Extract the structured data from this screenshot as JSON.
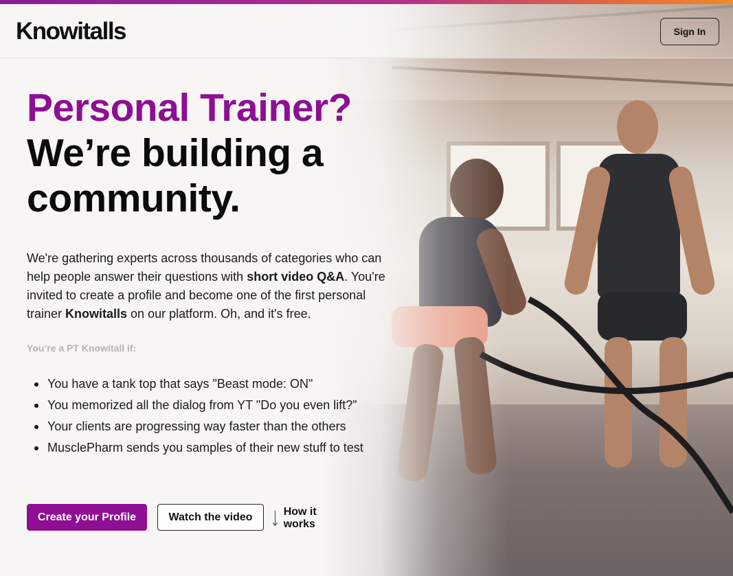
{
  "app": {
    "logo": "Knowitalls"
  },
  "header": {
    "signin_label": "Sign In"
  },
  "hero": {
    "title_accent": "Personal Trainer?",
    "title_rest": "We’re building a community."
  },
  "intro": {
    "p1": "We're gathering experts across thousands of categories who can help people answer their questions with ",
    "b1": "short video Q&A",
    "p2": ". You're invited to create a profile and become one of the first personal trainer ",
    "b2": "Knowitalls",
    "p3": " on our platform. Oh, and it's free."
  },
  "checklist": {
    "label": "You’re a PT Knowitall if:",
    "items": [
      "You have a tank top that says \"Beast mode: ON\"",
      "You memorized all the dialog from YT \"Do you even lift?\"",
      "Your clients are progressing way faster than the others",
      "MusclePharm sends you samples of their new stuff to test"
    ]
  },
  "actions": {
    "create_label": "Create your Profile",
    "watch_label": "Watch the video",
    "how_label": "How it works"
  },
  "colors": {
    "accent": "#8e0e94",
    "text": "#0b0b0b",
    "muted": "#b7b3ae",
    "background": "#f7f6f4"
  },
  "icons": {
    "how_it_works": "arrow-down-icon"
  }
}
